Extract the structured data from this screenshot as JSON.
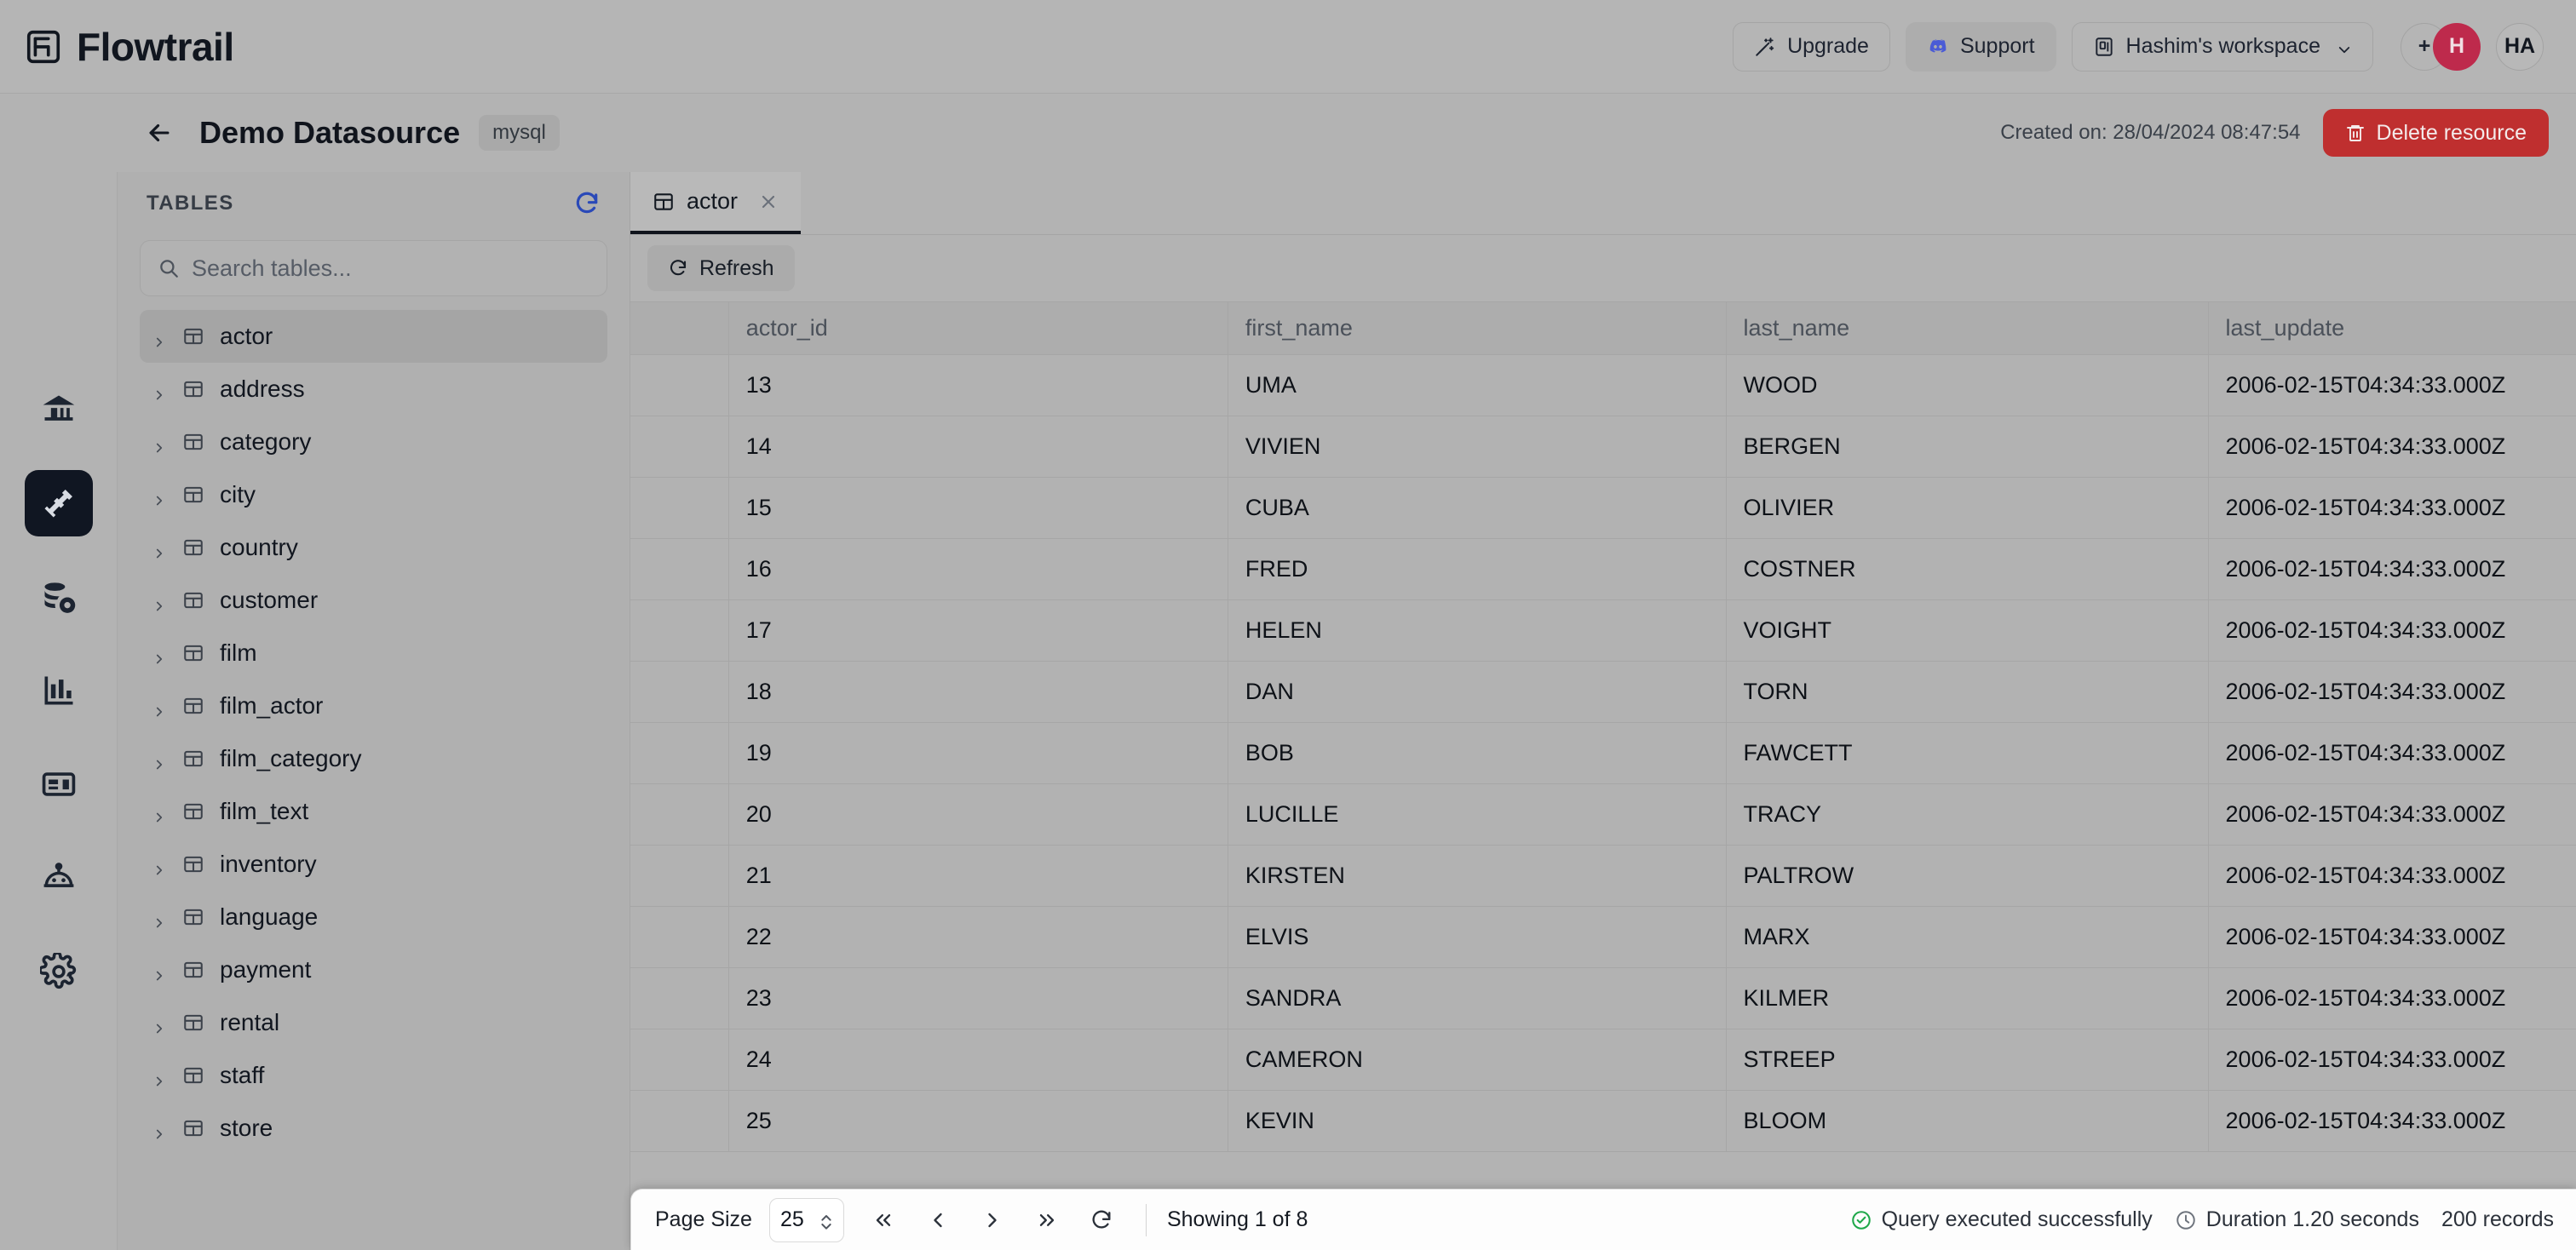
{
  "app": {
    "brand_name": "Flowtrail",
    "brand_icon": "flowtrail-logo-icon"
  },
  "topbar": {
    "upgrade_label": "Upgrade",
    "upgrade_icon": "sparkle-wand-icon",
    "support_label": "Support",
    "support_icon": "discord-icon",
    "workspace_label": "Hashim's workspace",
    "workspace_icon": "workspace-icon",
    "workspace_chevron_icon": "chevron-down-icon",
    "add_label": "+",
    "avatar_primary_initial": "H",
    "avatar_secondary_initials": "HA",
    "avatar_primary_color": "#be2a4c"
  },
  "subheader": {
    "back_icon": "arrow-left-icon",
    "title": "Demo Datasource",
    "engine_badge": "mysql",
    "created_on": "Created on: 28/04/2024 08:47:54",
    "delete_label": "Delete resource",
    "delete_icon": "trash-icon",
    "delete_color": "#bf2f2f"
  },
  "rail": {
    "items": [
      {
        "name": "home",
        "icon": "bank-home-icon",
        "active": false
      },
      {
        "name": "connections",
        "icon": "plug-icon",
        "active": true
      },
      {
        "name": "datasources",
        "icon": "database-gear-icon",
        "active": false
      },
      {
        "name": "charts",
        "icon": "bar-chart-icon",
        "active": false
      },
      {
        "name": "dashboards",
        "icon": "dashboard-card-icon",
        "active": false
      },
      {
        "name": "ai-agent",
        "icon": "robot-icon",
        "active": false
      },
      {
        "name": "settings",
        "icon": "gear-icon",
        "active": false
      }
    ]
  },
  "tables_panel": {
    "title": "TABLES",
    "refresh_icon": "refresh-icon",
    "refresh_color": "#2a49b8",
    "search_placeholder": "Search tables...",
    "search_value": "",
    "search_icon": "search-icon",
    "items": [
      {
        "label": "actor",
        "selected": true
      },
      {
        "label": "address",
        "selected": false
      },
      {
        "label": "category",
        "selected": false
      },
      {
        "label": "city",
        "selected": false
      },
      {
        "label": "country",
        "selected": false
      },
      {
        "label": "customer",
        "selected": false
      },
      {
        "label": "film",
        "selected": false
      },
      {
        "label": "film_actor",
        "selected": false
      },
      {
        "label": "film_category",
        "selected": false
      },
      {
        "label": "film_text",
        "selected": false
      },
      {
        "label": "inventory",
        "selected": false
      },
      {
        "label": "language",
        "selected": false
      },
      {
        "label": "payment",
        "selected": false
      },
      {
        "label": "rental",
        "selected": false
      },
      {
        "label": "staff",
        "selected": false
      },
      {
        "label": "store",
        "selected": false
      }
    ]
  },
  "main": {
    "tabs": [
      {
        "label": "actor",
        "icon": "table-icon",
        "active": true,
        "close_icon": "close-icon"
      }
    ],
    "refresh_label": "Refresh",
    "refresh_icon": "refresh-icon"
  },
  "grid": {
    "columns": [
      "actor_id",
      "first_name",
      "last_name",
      "last_update"
    ],
    "rows": [
      [
        "13",
        "UMA",
        "WOOD",
        "2006-02-15T04:34:33.000Z"
      ],
      [
        "14",
        "VIVIEN",
        "BERGEN",
        "2006-02-15T04:34:33.000Z"
      ],
      [
        "15",
        "CUBA",
        "OLIVIER",
        "2006-02-15T04:34:33.000Z"
      ],
      [
        "16",
        "FRED",
        "COSTNER",
        "2006-02-15T04:34:33.000Z"
      ],
      [
        "17",
        "HELEN",
        "VOIGHT",
        "2006-02-15T04:34:33.000Z"
      ],
      [
        "18",
        "DAN",
        "TORN",
        "2006-02-15T04:34:33.000Z"
      ],
      [
        "19",
        "BOB",
        "FAWCETT",
        "2006-02-15T04:34:33.000Z"
      ],
      [
        "20",
        "LUCILLE",
        "TRACY",
        "2006-02-15T04:34:33.000Z"
      ],
      [
        "21",
        "KIRSTEN",
        "PALTROW",
        "2006-02-15T04:34:33.000Z"
      ],
      [
        "22",
        "ELVIS",
        "MARX",
        "2006-02-15T04:34:33.000Z"
      ],
      [
        "23",
        "SANDRA",
        "KILMER",
        "2006-02-15T04:34:33.000Z"
      ],
      [
        "24",
        "CAMERON",
        "STREEP",
        "2006-02-15T04:34:33.000Z"
      ],
      [
        "25",
        "KEVIN",
        "BLOOM",
        "2006-02-15T04:34:33.000Z"
      ]
    ]
  },
  "statusbar": {
    "page_size_label": "Page Size",
    "page_size_value": "25",
    "first_page_icon": "chevrons-left-icon",
    "prev_page_icon": "chevron-left-icon",
    "next_page_icon": "chevron-right-icon",
    "last_page_icon": "chevrons-right-icon",
    "refresh_icon": "refresh-icon",
    "showing": "Showing 1 of 8",
    "query_status": "Query executed successfully",
    "query_status_icon": "check-circle-icon",
    "query_status_color": "#1fa84a",
    "duration": "Duration 1.20 seconds",
    "duration_icon": "clock-icon",
    "records": "200 records"
  }
}
